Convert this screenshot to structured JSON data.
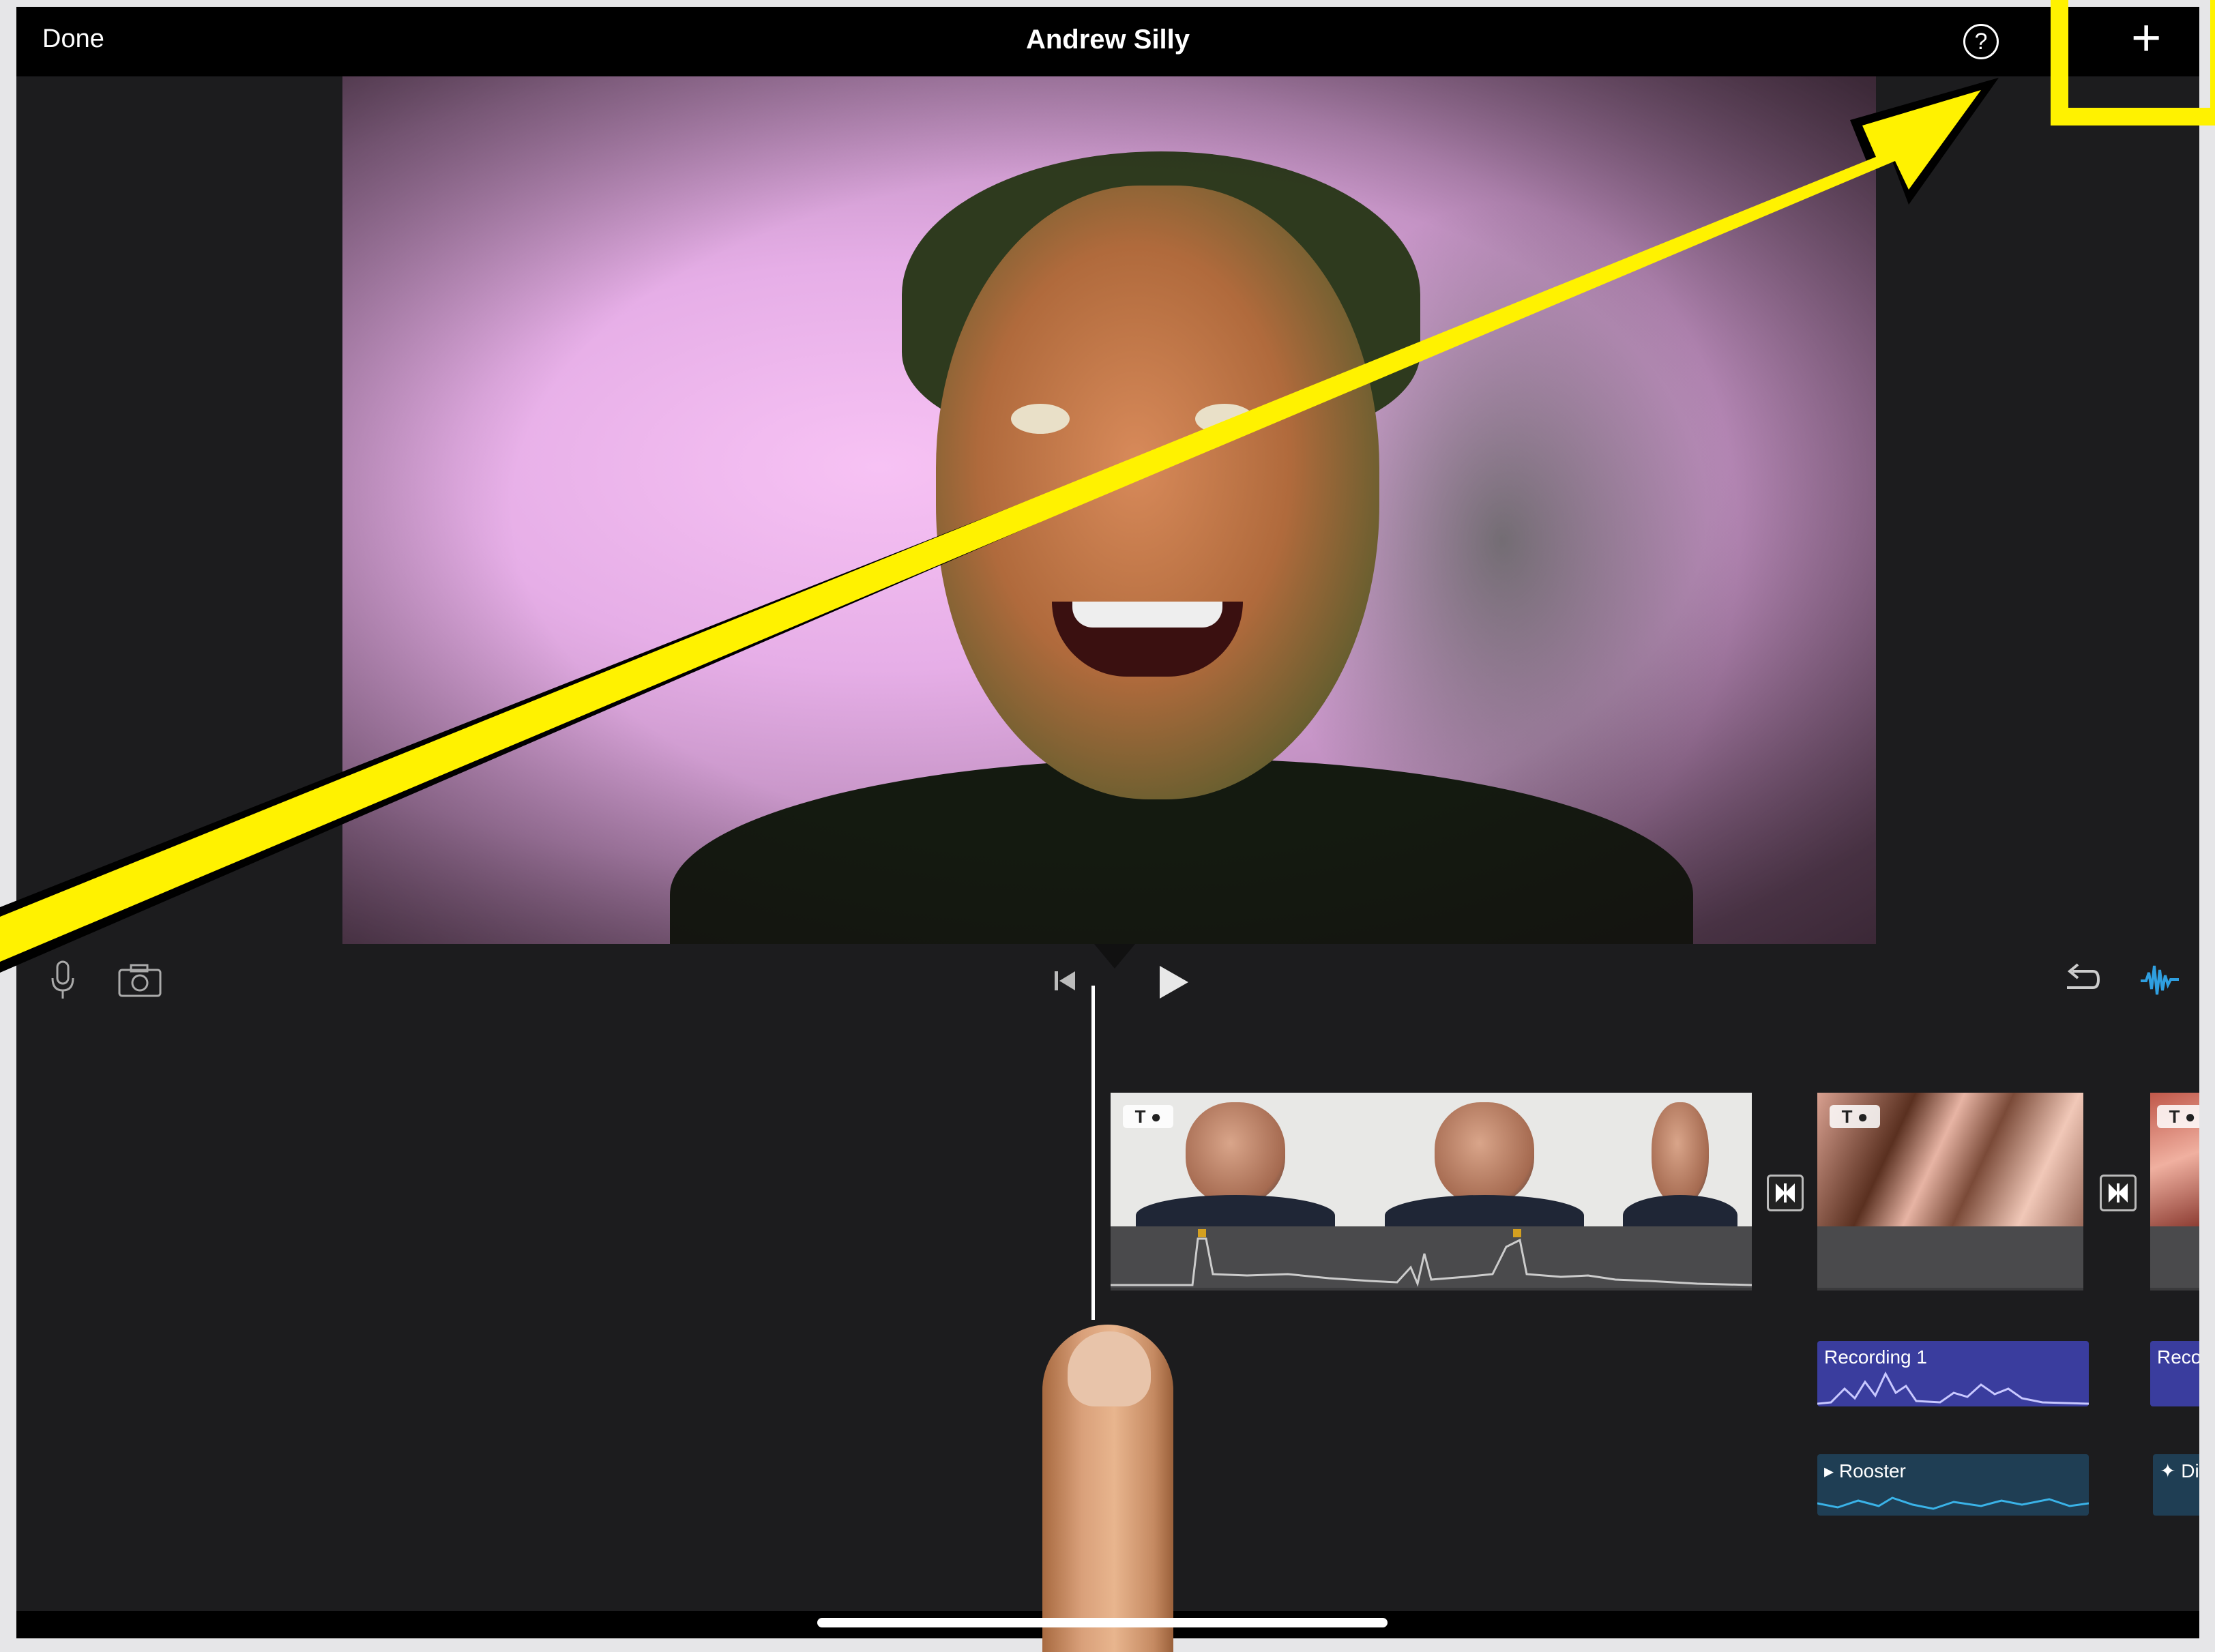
{
  "topbar": {
    "done_label": "Done",
    "project_title": "Andrew Silly",
    "help_symbol": "?",
    "add_symbol": "+"
  },
  "icons": {
    "microphone": "microphone-icon",
    "camera": "camera-icon",
    "skip_to_start": "skip-to-start-icon",
    "play": "play-icon",
    "undo": "undo-icon",
    "audio_waveform": "audio-waveform-icon",
    "transition": "transition-icon",
    "title_text": "T",
    "filter": "filter-icon"
  },
  "timeline": {
    "audio_clips": [
      {
        "label": "Recording 1"
      },
      {
        "label": "Reco"
      }
    ],
    "sound_effects": [
      {
        "label": "Rooster"
      },
      {
        "label": "Di"
      }
    ]
  },
  "colors": {
    "highlight": "#fff200",
    "accent_blue": "#2f9fe0",
    "recording": "#3a3d9e",
    "sound_effect": "#1f3e54"
  }
}
